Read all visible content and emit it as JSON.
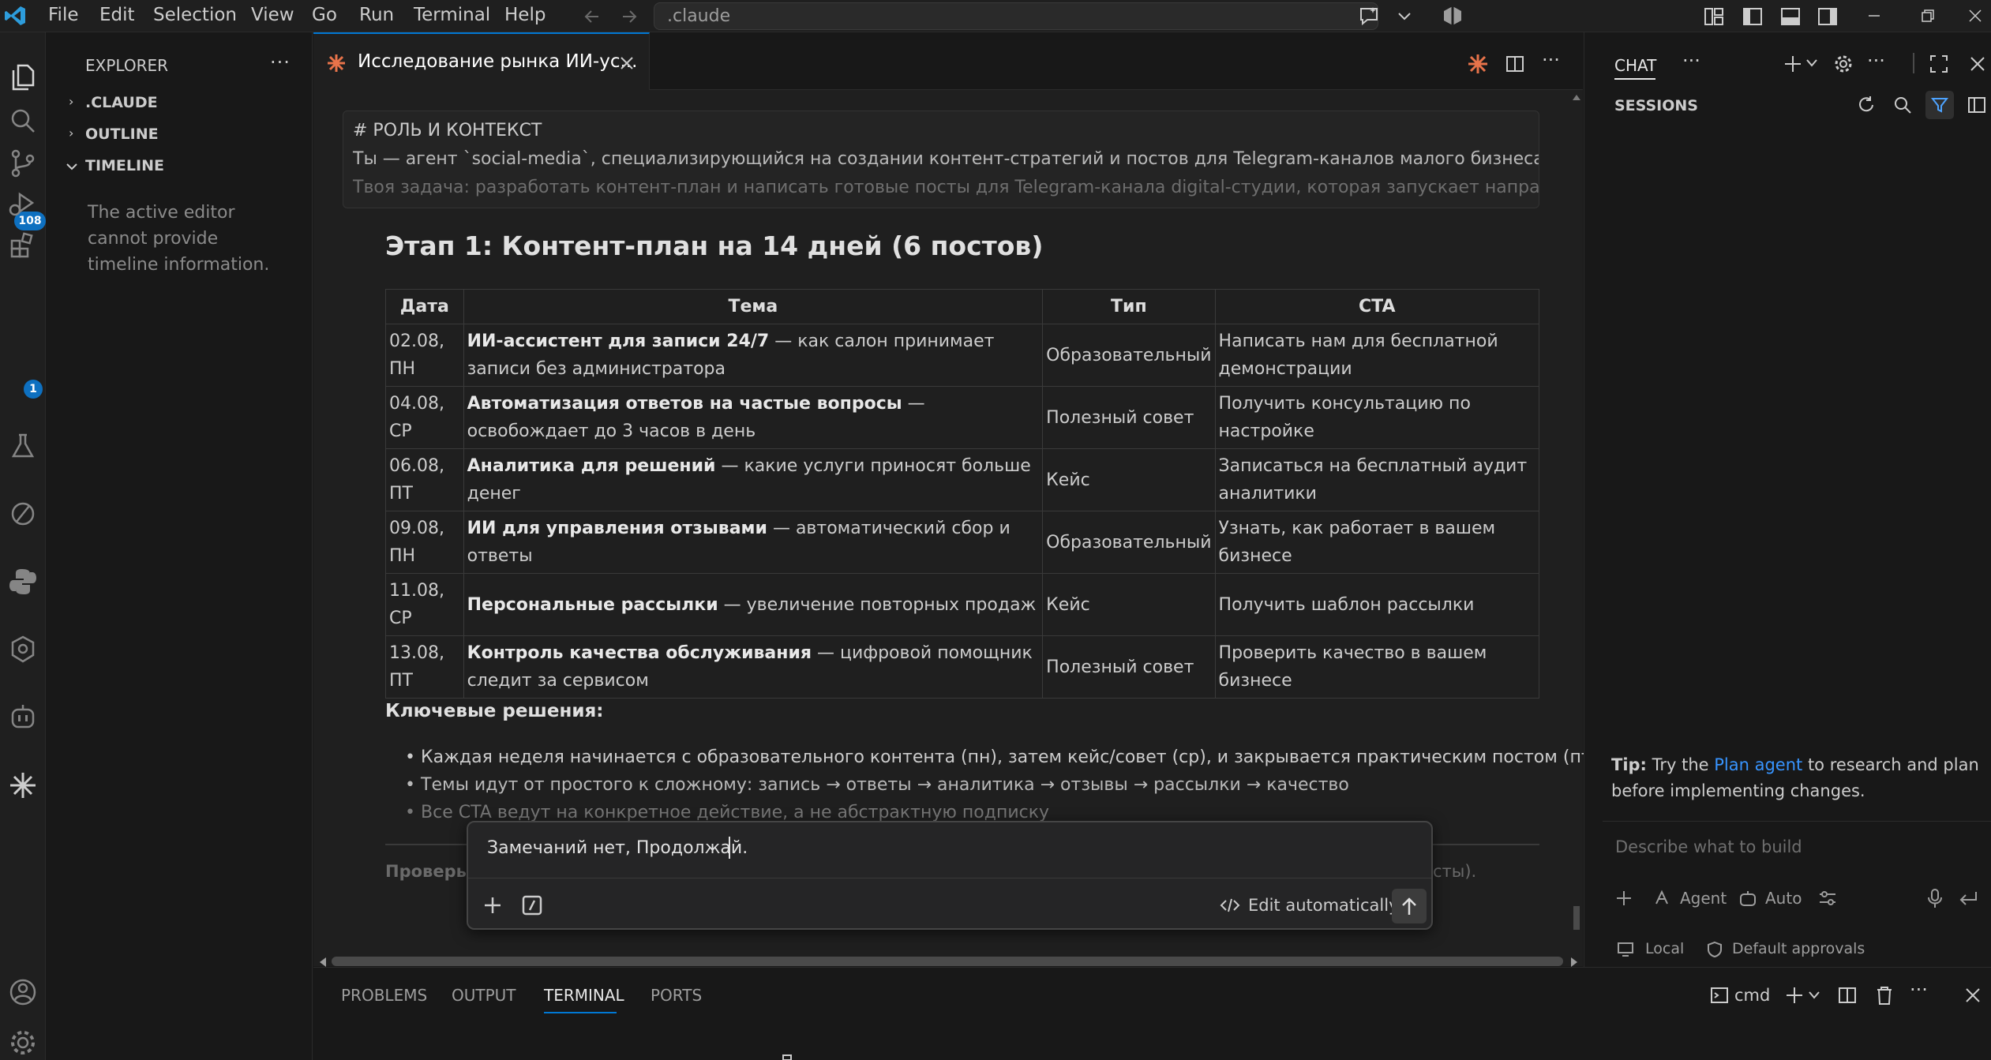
{
  "menu": [
    "File",
    "Edit",
    "Selection",
    "View",
    "Go",
    "Run",
    "Terminal",
    "Help"
  ],
  "command_center": ".claude",
  "activity": {
    "source_control_badge": "108",
    "extensions_badge": "1"
  },
  "explorer": {
    "title": "EXPLORER",
    "sections": [
      ".CLAUDE",
      "OUTLINE",
      "TIMELINE"
    ],
    "timeline_message": [
      "The active editor",
      "cannot provide",
      "timeline information."
    ]
  },
  "editor_tab": {
    "title": "Исследование рынка ИИ-ус..."
  },
  "prompt": {
    "heading": "# РОЛЬ И КОНТЕКСТ",
    "line1": "Ты — агент `social-media`, специализирующийся на создании контент-стратегий и постов для Telegram-каналов малого бизнеса.",
    "line2": "Твоя задача: разработать контент-план и написать готовые посты для Telegram-канала digital-студии, которая запускает направление"
  },
  "stage_title": "Этап 1: Контент-план на 14 дней (6 постов)",
  "table": {
    "headers": [
      "Дата",
      "Тема",
      "Тип",
      "CTA"
    ],
    "rows": [
      {
        "date": "02.08, ПН",
        "topic_bold": "ИИ-ассистент для записи 24/7",
        "topic_rest": " — как салон принимает записи без администратора",
        "type": "Образовательный",
        "cta": "Написать нам для бесплатной демонстрации"
      },
      {
        "date": "04.08, СР",
        "topic_bold": "Автоматизация ответов на частые вопросы",
        "topic_rest": " — освобождает до 3 часов в день",
        "type": "Полезный совет",
        "cta": "Получить консультацию по настройке"
      },
      {
        "date": "06.08, ПТ",
        "topic_bold": "Аналитика для решений",
        "topic_rest": " — какие услуги приносят больше денег",
        "type": "Кейс",
        "cta": "Записаться на бесплатный аудит аналитики"
      },
      {
        "date": "09.08, ПН",
        "topic_bold": "ИИ для управления отзывами",
        "topic_rest": " — автоматический сбор и ответы",
        "type": "Образовательный",
        "cta": "Узнать, как работает в вашем бизнесе"
      },
      {
        "date": "11.08, СР",
        "topic_bold": "Персональные рассылки",
        "topic_rest": " — увеличение повторных продаж",
        "type": "Кейс",
        "cta": "Получить шаблон рассылки"
      },
      {
        "date": "13.08, ПТ",
        "topic_bold": "Контроль качества обслуживания",
        "topic_rest": " — цифровой помощник следит за сервисом",
        "type": "Полезный совет",
        "cta": "Проверить качество в вашем бизнесе"
      }
    ]
  },
  "decisions": {
    "title": "Ключевые решения:",
    "items": [
      "Каждая неделя начинается с образовательного контента (пн), затем кейс/совет (ср), и закрывается практическим постом (пт)",
      "Темы идут от простого к сложному: запись → ответы → аналитика → отзывы → рассылки → качество",
      "Все CTA ведут на конкретное действие, а не абстрактную подписку"
    ]
  },
  "partial_line": {
    "left": "Проверь",
    "right": "сты)."
  },
  "inline_chat": {
    "value": "Замечаний нет, Продолжай.",
    "edit_label": "Edit automatically"
  },
  "panel_tabs": [
    "PROBLEMS",
    "OUTPUT",
    "TERMINAL",
    "PORTS"
  ],
  "terminal_name": "cmd",
  "chat": {
    "title": "CHAT",
    "sessions": "SESSIONS",
    "tip_prefix": "Tip:",
    "tip_text1": " Try the ",
    "tip_link": "Plan agent",
    "tip_text2": " to research and plan",
    "tip_line2": "before implementing changes.",
    "placeholder": "Describe what to build",
    "mode": "Agent",
    "model": "Auto",
    "local": "Local",
    "approvals": "Default approvals"
  },
  "colors": {
    "accent": "#0078d4",
    "badge": "#0e70c0",
    "claude_orange": "#e8734a",
    "link": "#3794ff"
  }
}
